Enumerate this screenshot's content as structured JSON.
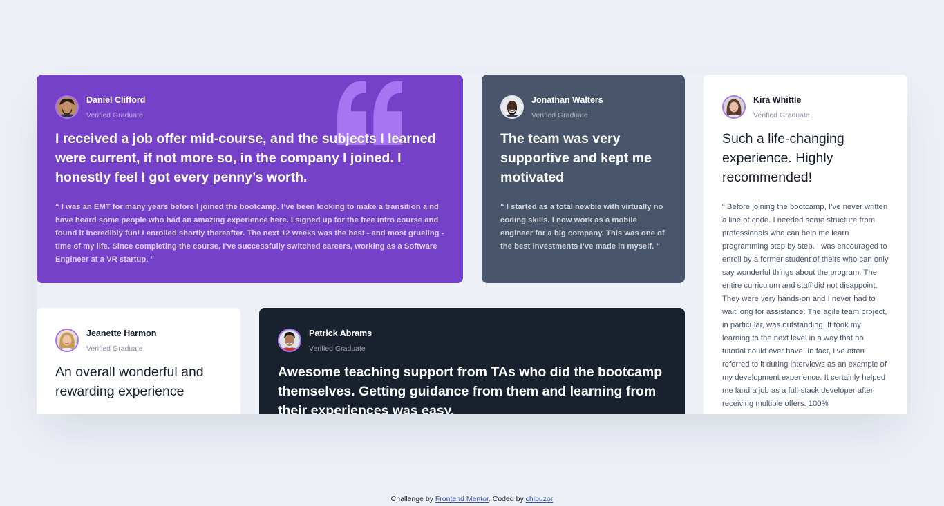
{
  "colors": {
    "page_bg": "#edf0f7",
    "purple": "#7541c8",
    "grayish_blue": "#48556a",
    "dark_blue": "#19212e",
    "white": "#ffffff",
    "quote_mark": "#a775f1"
  },
  "testimonials": [
    {
      "name": "Daniel Clifford",
      "status": "Verified Graduate",
      "headline": "I received a job offer mid-course, and the subjects I learned were current, if not more so, in the company I joined. I honestly feel I got every penny’s worth.",
      "body": "“ I was an EMT for many years before I joined the bootcamp. I’ve been looking to make a transition a nd have heard some people who had an amazing experience here. I signed up for the free intro course and found it incredibly fun! I enrolled shortly thereafter. The next 12 weeks was the best - and most grueling - time of my life. Since completing the course, I’ve successfully switched careers, working as a Software Engineer at a VR startup. ”",
      "avatar_icon": "avatar-daniel-icon"
    },
    {
      "name": "Jonathan Walters",
      "status": "Verified Graduate",
      "headline": "The team was very supportive and kept me motivated",
      "body": "“ I started as a total newbie with virtually no coding skills. I now work as a mobile engineer for a big company. This was one of the best investments I’ve made in myself. ”",
      "avatar_icon": "avatar-jonathan-icon"
    },
    {
      "name": "Kira Whittle",
      "status": "Verified Graduate",
      "headline": "Such a life-changing experience. Highly recommended!",
      "body": "“ Before joining the bootcamp, I’ve never written a line of code. I needed some structure from professionals who can help me learn programming step by step. I was encouraged to enroll by a former student of theirs who can only say wonderful things about the program. The entire curriculum and staff did not disappoint. They were very hands-on and I never had to wait long for assistance. The agile team project, in particular, was outstanding. It took my learning to the next level in a way that no tutorial could ever have. In fact, I’ve often referred to it during interviews as an example of my development experience. It certainly helped me land a job as a full-stack developer after receiving multiple offers. 100%",
      "avatar_icon": "avatar-kira-icon"
    },
    {
      "name": "Jeanette Harmon",
      "status": "Verified Graduate",
      "headline": "An overall wonderful and rewarding experience",
      "avatar_icon": "avatar-jeanette-icon"
    },
    {
      "name": "Patrick Abrams",
      "status": "Verified Graduate",
      "headline": "Awesome teaching support from TAs who did the bootcamp themselves. Getting guidance from them and learning from their experiences was easy.",
      "avatar_icon": "avatar-patrick-icon"
    }
  ],
  "footer": {
    "prefix": "Challenge by",
    "link1": "Frontend Mentor",
    "middle": ". Coded by",
    "link2": "chibuzor"
  }
}
